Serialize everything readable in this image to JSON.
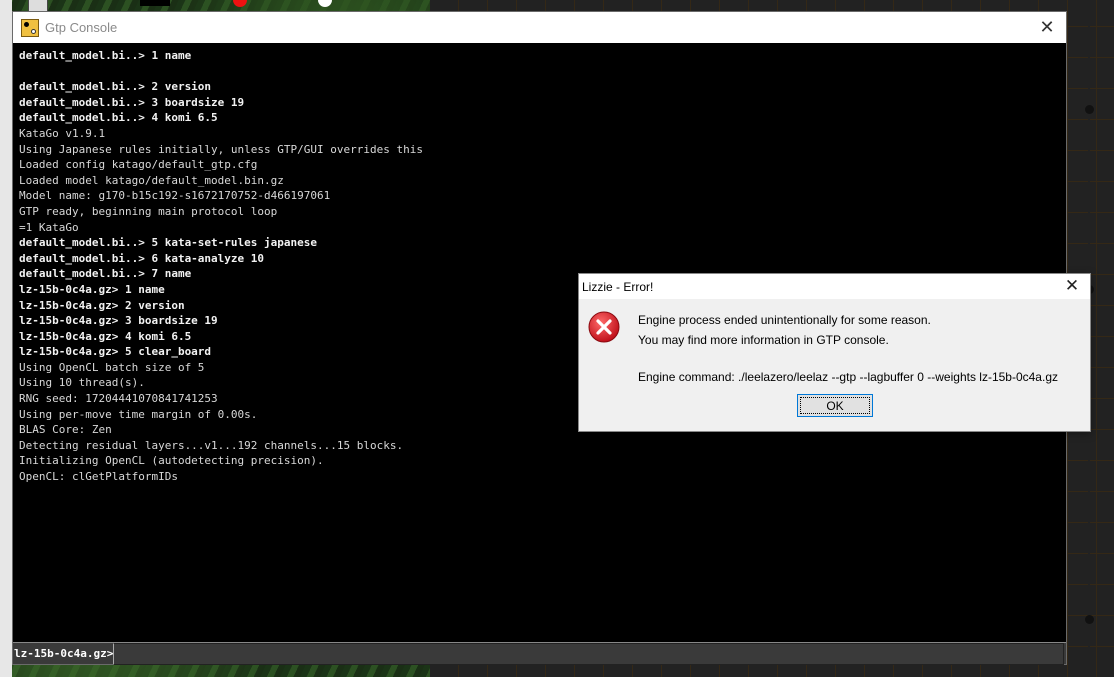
{
  "console": {
    "title": "Gtp Console",
    "close_symbol": "✕",
    "lines": [
      {
        "text": "default_model.bi..> 1 name",
        "cmd": true
      },
      {
        "text": "",
        "cmd": false
      },
      {
        "text": "default_model.bi..> 2 version",
        "cmd": true
      },
      {
        "text": "default_model.bi..> 3 boardsize 19",
        "cmd": true
      },
      {
        "text": "default_model.bi..> 4 komi 6.5",
        "cmd": true
      },
      {
        "text": "KataGo v1.9.1",
        "cmd": false
      },
      {
        "text": "Using Japanese rules initially, unless GTP/GUI overrides this",
        "cmd": false
      },
      {
        "text": "Loaded config katago/default_gtp.cfg",
        "cmd": false
      },
      {
        "text": "Loaded model katago/default_model.bin.gz",
        "cmd": false
      },
      {
        "text": "Model name: g170-b15c192-s1672170752-d466197061",
        "cmd": false
      },
      {
        "text": "GTP ready, beginning main protocol loop",
        "cmd": false
      },
      {
        "text": "=1 KataGo",
        "cmd": false
      },
      {
        "text": "default_model.bi..> 5 kata-set-rules japanese",
        "cmd": true
      },
      {
        "text": "default_model.bi..> 6 kata-analyze 10",
        "cmd": true
      },
      {
        "text": "default_model.bi..> 7 name",
        "cmd": true
      },
      {
        "text": "lz-15b-0c4a.gz> 1 name",
        "cmd": true
      },
      {
        "text": "lz-15b-0c4a.gz> 2 version",
        "cmd": true
      },
      {
        "text": "lz-15b-0c4a.gz> 3 boardsize 19",
        "cmd": true
      },
      {
        "text": "lz-15b-0c4a.gz> 4 komi 6.5",
        "cmd": true
      },
      {
        "text": "lz-15b-0c4a.gz> 5 clear_board",
        "cmd": true
      },
      {
        "text": "Using OpenCL batch size of 5",
        "cmd": false
      },
      {
        "text": "Using 10 thread(s).",
        "cmd": false
      },
      {
        "text": "RNG seed: 17204441070841741253",
        "cmd": false
      },
      {
        "text": "Using per-move time margin of 0.00s.",
        "cmd": false
      },
      {
        "text": "BLAS Core: Zen",
        "cmd": false
      },
      {
        "text": "Detecting residual layers...v1...192 channels...15 blocks.",
        "cmd": false
      },
      {
        "text": "Initializing OpenCL (autodetecting precision).",
        "cmd": false
      },
      {
        "text": "OpenCL: clGetPlatformIDs",
        "cmd": false
      }
    ],
    "prompt": "lz-15b-0c4a.gz>",
    "input_value": ""
  },
  "dialog": {
    "title": "Lizzie - Error!",
    "close_symbol": "✕",
    "message_line1": "Engine process ended unintentionally for some reason.",
    "message_line2": "You may find more information in GTP console.",
    "command_line": "Engine command: ./leelazero/leelaz --gtp --lagbuffer 0 --weights lz-15b-0c4a.gz",
    "ok_label": "OK",
    "icon": "error-icon"
  },
  "colors": {
    "console_bg": "#000000",
    "console_text": "#d8d8d8",
    "dialog_bg": "#f0f0f0",
    "error_red": "#d9232e",
    "board_wood": "#d7a45a",
    "button_focus": "#0078d7"
  }
}
